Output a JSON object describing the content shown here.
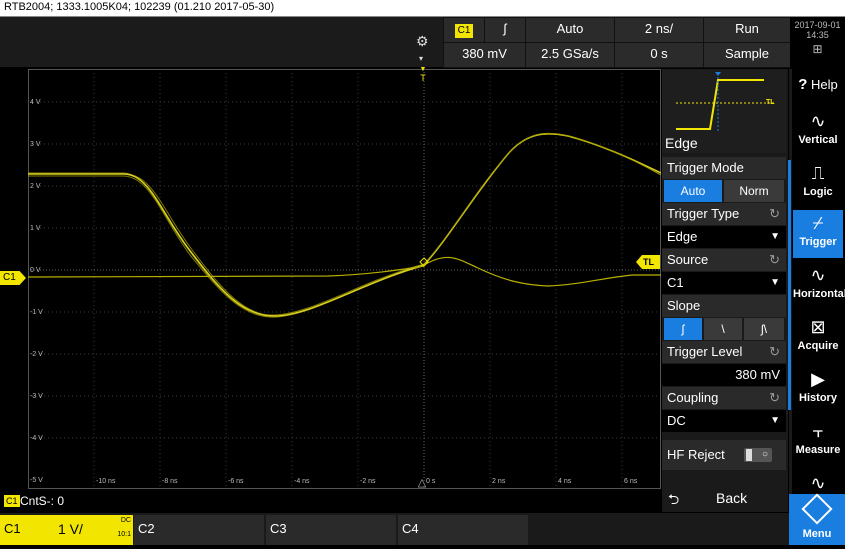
{
  "title": "RTB2004; 1333.1005K04; 102239 (01.210 2017-05-30)",
  "header": {
    "channel": "C1",
    "slope_symbol": "ʃ",
    "trigger_mode": "Auto",
    "time_per_div": "2 ns/",
    "run_state": "Run",
    "voltage_per_div": "380 mV",
    "sample_rate": "2.5 GSa/s",
    "time_offset": "0 s",
    "acq_mode": "Sample",
    "date": "2017-09-01",
    "time": "14:35"
  },
  "grid": {
    "y_labels": [
      "4 V",
      "3 V",
      "2 V",
      "1 V",
      "0 V",
      "-1 V",
      "-2 V",
      "-3 V",
      "-4 V",
      "-5 V"
    ],
    "x_labels": [
      "-10 ns",
      "-8 ns",
      "-6 ns",
      "-4 ns",
      "-2 ns",
      "0 s",
      "2 ns",
      "4 ns",
      "6 ns"
    ],
    "trigger_marker": "T",
    "trigger_level_marker": "TL",
    "channel_marker": "C1"
  },
  "panel": {
    "preview_label": "TL",
    "title": "Edge",
    "trigger_mode_label": "Trigger Mode",
    "trigger_mode_options": [
      "Auto",
      "Norm"
    ],
    "trigger_type_label": "Trigger Type",
    "trigger_type_value": "Edge",
    "source_label": "Source",
    "source_value": "C1",
    "slope_label": "Slope",
    "slope_options": [
      "ʃ",
      "\\",
      "ʃ\\"
    ],
    "trigger_level_label": "Trigger Level",
    "trigger_level_value": "380 mV",
    "coupling_label": "Coupling",
    "coupling_value": "DC",
    "hf_reject_label": "HF Reject",
    "back_label": "Back"
  },
  "toolbar": {
    "help": "Help",
    "vertical": "Vertical",
    "logic": "Logic",
    "trigger": "Trigger",
    "horizontal": "Horizontal",
    "acquire": "Acquire",
    "history": "History",
    "measure": "Measure",
    "menu": "Menu"
  },
  "bottom": {
    "cnts_channel": "C1",
    "cnts_text": "CntS-: 0",
    "c1_label": "C1",
    "c1_scale": "1 V/",
    "c1_coupling": "DC",
    "c1_probe": "10:1",
    "c2_label": "C2",
    "c3_label": "C3",
    "c4_label": "C4"
  },
  "colors": {
    "trace": "#d8d020",
    "accent": "#1a7de0",
    "channel1": "#f2e600"
  }
}
